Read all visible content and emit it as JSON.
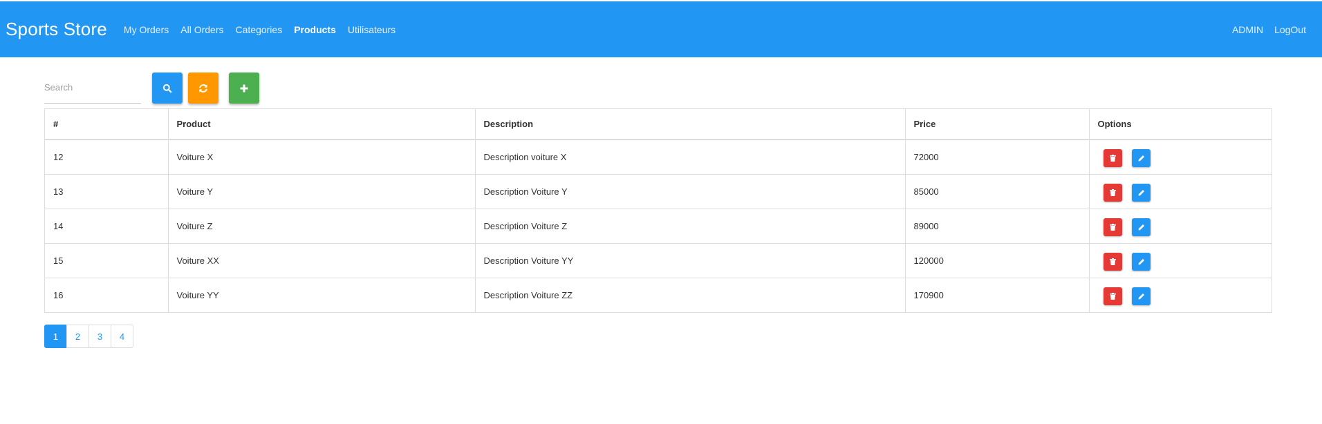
{
  "navbar": {
    "brand": "Sports Store",
    "links": [
      "My Orders",
      "All Orders",
      "Categories",
      "Products",
      "Utilisateurs"
    ],
    "active": "Products",
    "right": {
      "user": "ADMIN",
      "logout": "LogOut"
    },
    "color": "#2196f3"
  },
  "toolbar": {
    "search_placeholder": "Search",
    "buttons": [
      {
        "name": "search-button",
        "icon": "search-icon",
        "color": "#2196f3"
      },
      {
        "name": "refresh-button",
        "icon": "refresh-icon",
        "color": "#ff9800"
      },
      {
        "name": "add-button",
        "icon": "plus-icon",
        "color": "#4caf50"
      }
    ]
  },
  "table": {
    "headers": [
      "#",
      "Product",
      "Description",
      "Price",
      "Options"
    ],
    "rows": [
      {
        "id": "12",
        "product": "Voiture X",
        "description": "Description voiture X",
        "price": "72000"
      },
      {
        "id": "13",
        "product": "Voiture Y",
        "description": "Description Voiture Y",
        "price": "85000"
      },
      {
        "id": "14",
        "product": "Voiture Z",
        "description": "Description Voiture Z",
        "price": "89000"
      },
      {
        "id": "15",
        "product": "Voiture XX",
        "description": "Description Voiture YY",
        "price": "120000"
      },
      {
        "id": "16",
        "product": "Voiture YY",
        "description": "Description Voiture ZZ",
        "price": "170900"
      }
    ],
    "row_actions": [
      {
        "name": "delete-button",
        "icon": "trash-icon",
        "color": "#e53935"
      },
      {
        "name": "edit-button",
        "icon": "pencil-icon",
        "color": "#2196f3"
      }
    ]
  },
  "pagination": {
    "pages": [
      "1",
      "2",
      "3",
      "4"
    ],
    "current": "1"
  }
}
